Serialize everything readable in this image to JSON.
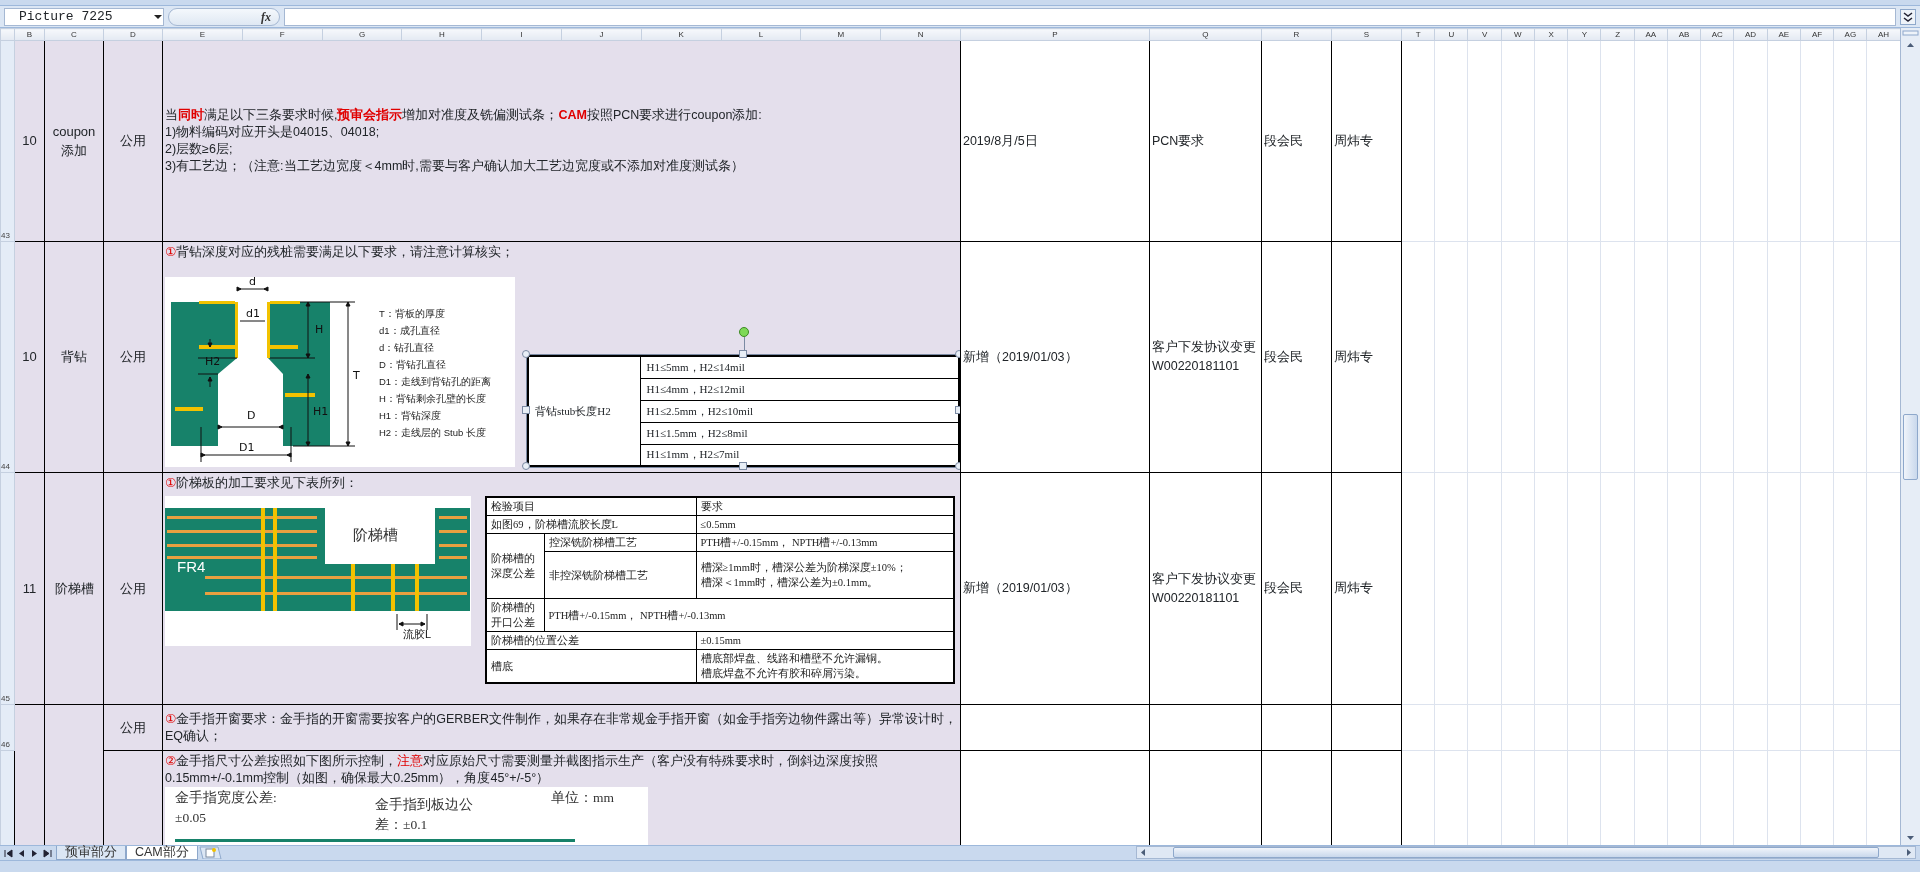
{
  "formula_bar": {
    "name_box": "Picture 7225",
    "function_label": "fx"
  },
  "column_headers": [
    "B",
    "C",
    "D",
    "E",
    "F",
    "G",
    "H",
    "I",
    "J",
    "K",
    "L",
    "M",
    "N",
    "P",
    "Q",
    "R",
    "S",
    "T",
    "U",
    "V",
    "W",
    "X",
    "Y",
    "Z",
    "AA",
    "AB",
    "AC",
    "AD",
    "AE",
    "AF",
    "AG",
    "AH"
  ],
  "rows": [
    {
      "header": "43",
      "number": "10",
      "item": "coupon 添加",
      "scope": "公用",
      "paragraphs": [
        [
          {
            "text": "当",
            "kind": "plain"
          },
          {
            "text": "同时",
            "kind": "alert_bold"
          },
          {
            "text": "满足以下三条要求时候,",
            "kind": "plain"
          },
          {
            "text": "预审会指示",
            "kind": "alert_bold"
          },
          {
            "text": "增加对准度及铣偏测试条；",
            "kind": "plain"
          },
          {
            "text": "CAM",
            "kind": "alert_bold"
          },
          {
            "text": "按照PCN要求进行coupon添加:",
            "kind": "plain"
          }
        ],
        [
          {
            "text": "1)物料编码对应开头是04015、04018;",
            "kind": "plain"
          }
        ],
        [
          {
            "text": "2)层数≥6层;",
            "kind": "plain"
          }
        ],
        [
          {
            "text": "3)有工艺边；（注意:当工艺边宽度＜4mm时,需要与客户确认加大工艺边宽度或不添加对准度测试条）",
            "kind": "plain"
          }
        ]
      ],
      "date": "2019/8月/5日",
      "reason": "PCN要求",
      "owner": "段会民",
      "reviewer": "周炜专"
    },
    {
      "header": "44",
      "number": "10",
      "item": "背钻",
      "scope": "公用",
      "paragraphs": [
        [
          {
            "text": "①",
            "kind": "alert"
          },
          {
            "text": "背钻深度对应的残桩需要满足以下要求，请注意计算核实；",
            "kind": "plain"
          }
        ]
      ],
      "figures": [
        {
          "kind": "backdrill_diagram",
          "dimension_labels": [
            "d",
            "d1",
            "H",
            "H2",
            "T",
            "H1",
            "D",
            "D1"
          ],
          "legend": [
            "T：背板的厚度",
            "d1：成孔直径",
            "d：钻孔直径",
            "D：背钻孔直径",
            "D1：走线到背钻孔的距离",
            "H：背钻剩余孔壁的长度",
            "H1：背钻深度",
            "H2：走线层的 Stub 长度"
          ]
        },
        {
          "kind": "stub_table",
          "selected": true,
          "label": "背钻stub长度H2",
          "values": [
            "H1≤5mm，H2≤14mil",
            "H1≤4mm，H2≤12mil",
            "H1≤2.5mm，H2≤10mil",
            "H1≤1.5mm，H2≤8mil",
            "H1≤1mm，H2≤7mil"
          ]
        }
      ],
      "date": "新增（2019/01/03）",
      "reason": "客户下发协议变更W00220181101",
      "owner": "段会民",
      "reviewer": "周炜专"
    },
    {
      "header": "45",
      "number": "11",
      "item": "阶梯槽",
      "scope": "公用",
      "paragraphs": [
        [
          {
            "text": "①",
            "kind": "alert"
          },
          {
            "text": "阶梯板的加工要求见下表所列：",
            "kind": "plain"
          }
        ]
      ],
      "figures": [
        {
          "kind": "step_slot_diagram",
          "labels": [
            "阶梯槽",
            "FR4",
            "流胶L"
          ]
        },
        {
          "kind": "spec_table",
          "items": [
            {
              "kind": "wide",
              "label": "检验项目",
              "requirement": [
                "要求"
              ]
            },
            {
              "kind": "wide",
              "label": "如图69，阶梯槽流胶长度L",
              "requirement": [
                "≤0.5mm"
              ]
            },
            {
              "kind": "split",
              "label": "阶梯槽的深度公差",
              "parts": [
                {
                  "method": "控深铣阶梯槽工艺",
                  "requirement": [
                    "PTH槽+/-0.15mm， NPTH槽+/-0.13mm"
                  ]
                },
                {
                  "method": "非控深铣阶梯槽工艺",
                  "requirement": [
                    "槽深≥1mm时，槽深公差为阶梯深度±10%；",
                    "槽深＜1mm时，槽深公差为±0.1mm。"
                  ]
                }
              ]
            },
            {
              "kind": "merged",
              "label": "阶梯槽的开口公差",
              "requirement": [
                "PTH槽+/-0.15mm， NPTH槽+/-0.13mm"
              ]
            },
            {
              "kind": "wide",
              "label": "阶梯槽的位置公差",
              "requirement": [
                "±0.15mm"
              ]
            },
            {
              "kind": "wide",
              "label": "槽底",
              "requirement": [
                "槽底部焊盘、线路和槽壁不允许漏铜。",
                "槽底焊盘不允许有胶和碎屑污染。"
              ]
            }
          ]
        }
      ],
      "date": "新增（2019/01/03）",
      "reason": "客户下发协议变更W00220181101",
      "owner": "段会民",
      "reviewer": "周炜专"
    },
    {
      "header": "46",
      "scope": "公用",
      "paragraphs": [
        [
          {
            "text": "①",
            "kind": "alert"
          },
          {
            "text": "金手指开窗要求：金手指的开窗需要按客户的GERBER文件制作，如果存在非常规金手指开窗（如金手指旁边物件露出等）异常设计时，EQ确认；",
            "kind": "plain"
          }
        ]
      ]
    },
    {
      "kind": "continuation",
      "paragraphs": [
        [
          {
            "text": "②",
            "kind": "alert"
          },
          {
            "text": "金手指尺寸公差按照如下图所示控制，",
            "kind": "plain"
          },
          {
            "text": "注意",
            "kind": "alert"
          },
          {
            "text": "对应原始尺寸需要测量并截图指示生产（客户没有特殊要求时，倒斜边深度按照0.15mm+/-0.1mm控制（如图，确保最大0.25mm），角度45°+/-5°）",
            "kind": "plain"
          }
        ]
      ],
      "figures": [
        {
          "kind": "gold_finger_diagram",
          "width_tolerance": "金手指宽度公差:",
          "width_value": "±0.05",
          "edge_tolerance": "金手指到板边公差：±0.1",
          "unit": "单位：mm"
        }
      ]
    }
  ],
  "sheet_tabs": [
    {
      "label": "预审部分",
      "selected": false
    },
    {
      "label": "CAM部分",
      "selected": true
    }
  ]
}
